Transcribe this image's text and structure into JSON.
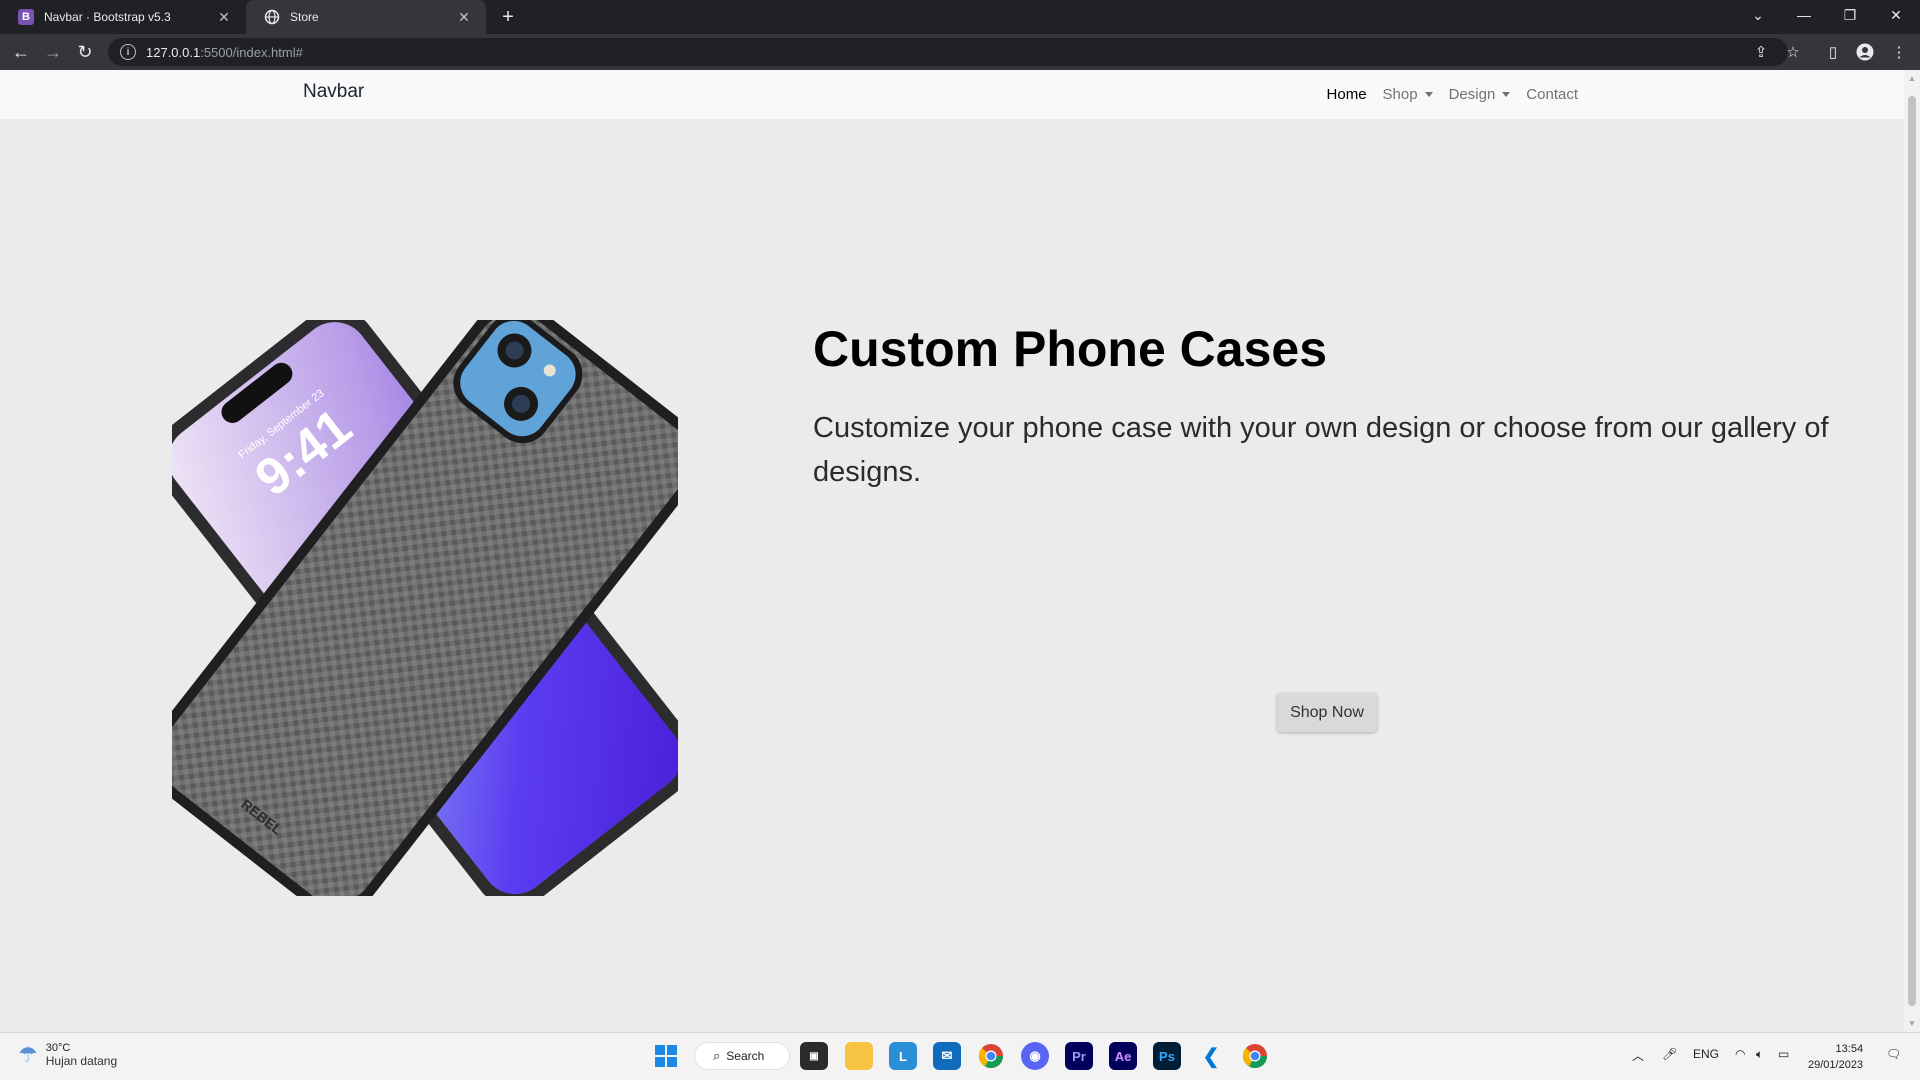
{
  "browser": {
    "tabs": [
      {
        "title": "Navbar · Bootstrap v5.3",
        "favicon": "bootstrap-icon",
        "active": false
      },
      {
        "title": "Store",
        "favicon": "globe-icon",
        "active": true
      }
    ],
    "url_host": "127.0.0.1",
    "url_rest": ":5500/index.html#"
  },
  "navbar": {
    "brand": "Navbar",
    "links": [
      {
        "label": "Home"
      },
      {
        "label": "Shop"
      },
      {
        "label": "Design"
      },
      {
        "label": "Contact"
      }
    ]
  },
  "hero": {
    "title": "Custom Phone Cases",
    "subtitle": "Customize your phone case with your own design or choose from our gallery of designs.",
    "button": "Shop Now",
    "phone_screen_time": "9:41",
    "phone_screen_date": "Friday, September 23",
    "phone_case_brand": "REBEL"
  },
  "taskbar": {
    "weather_temp": "30°C",
    "weather_desc": "Hujan datang",
    "search_label": "Search",
    "lang": "ENG",
    "time": "13:54",
    "date": "29/01/2023",
    "apps": [
      "windows-start-icon",
      "file-manager-icon",
      "files-folder-icon",
      "l-app-icon",
      "mail-icon",
      "chrome-icon",
      "discord-icon",
      "premiere-pro-icon",
      "after-effects-icon",
      "photoshop-icon",
      "vscode-icon",
      "chrome-profile-icon"
    ]
  }
}
